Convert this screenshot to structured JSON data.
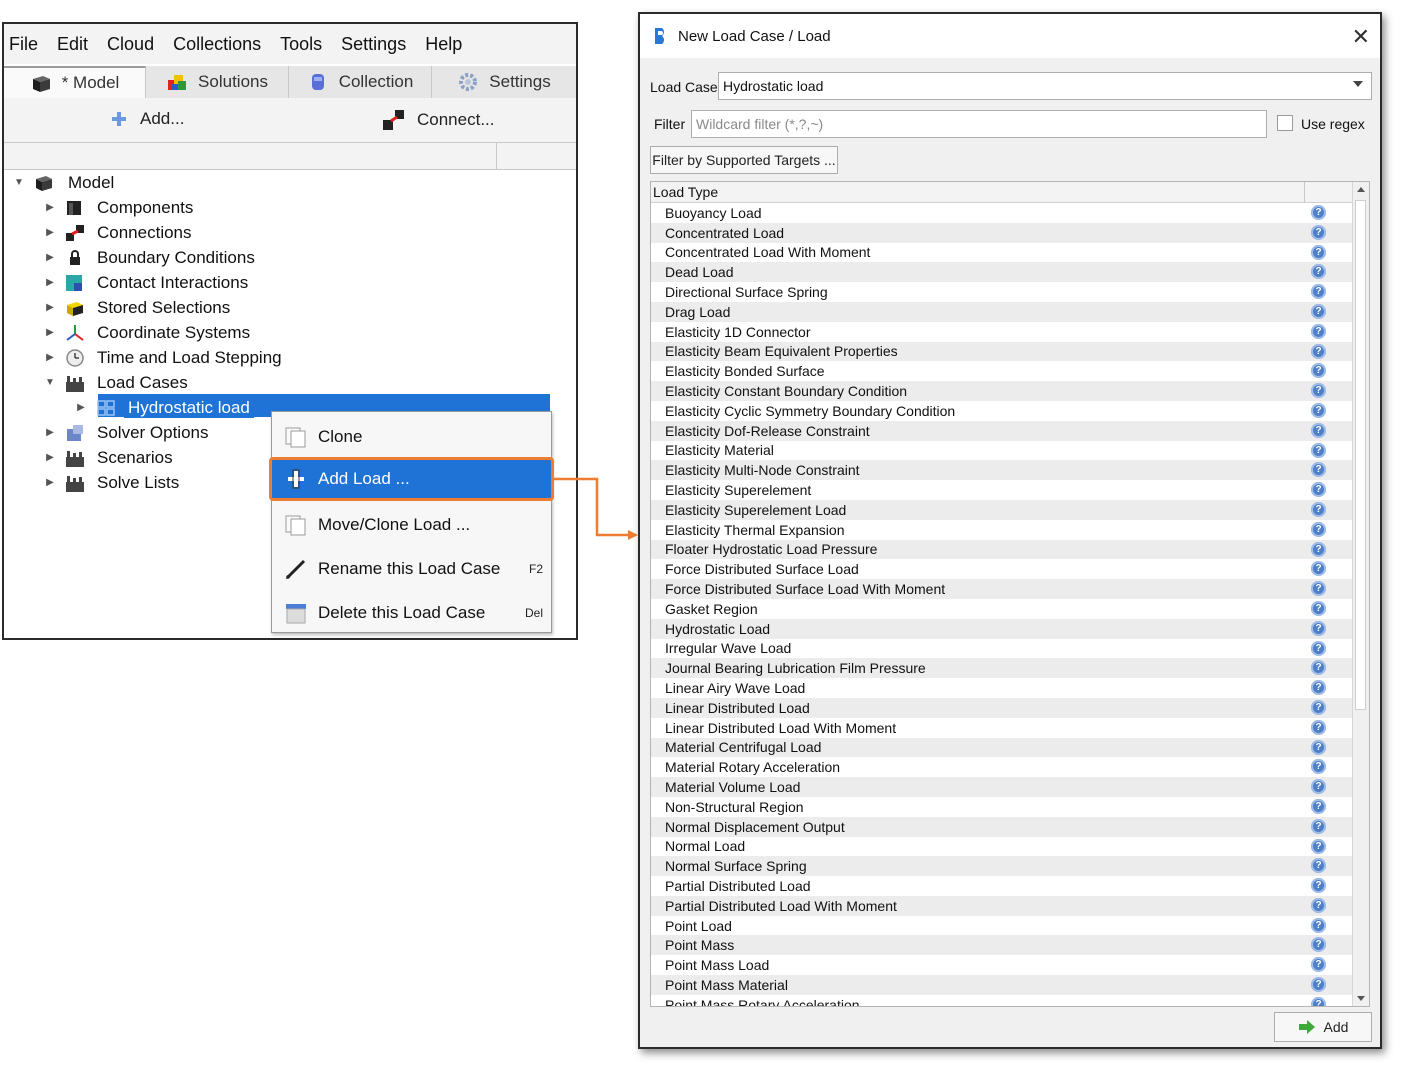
{
  "left_app": {
    "menu": [
      {
        "label": "File"
      },
      {
        "label": "Edit"
      },
      {
        "label": "Cloud"
      },
      {
        "label": "Collections"
      },
      {
        "label": "Tools"
      },
      {
        "label": "Settings"
      },
      {
        "label": "Help"
      }
    ],
    "tabs": [
      {
        "label": "* Model",
        "icon": "model-cube-icon",
        "active": true
      },
      {
        "label": "Solutions",
        "icon": "solutions-cubes-icon",
        "active": false
      },
      {
        "label": "Collection",
        "icon": "collection-icon",
        "active": false
      },
      {
        "label": "Settings",
        "icon": "gear-icon",
        "active": false
      }
    ],
    "toolbar": {
      "add_label": "Add...",
      "connect_label": "Connect..."
    },
    "tree": {
      "root": "Model",
      "items": [
        "Components",
        "Connections",
        "Boundary Conditions",
        "Contact Interactions",
        "Stored Selections",
        "Coordinate Systems",
        "Time and Load Stepping",
        "Load Cases",
        "Hydrostatic load",
        "Solver Options",
        "Scenarios",
        "Solve Lists"
      ]
    },
    "context_menu": {
      "clone": "Clone",
      "add_load": "Add Load ...",
      "move_clone": "Move/Clone Load ...",
      "rename": "Rename this Load Case",
      "rename_shortcut": "F2",
      "delete": "Delete this Load Case",
      "delete_shortcut": "Del"
    },
    "highlight_color": "#ed7d31",
    "selection_color": "#1f73d6"
  },
  "dialog": {
    "title": "New Load Case / Load",
    "load_case_label": "Load Case",
    "load_case_value": "Hydrostatic load",
    "filter_label": "Filter",
    "filter_placeholder": "Wildcard filter (*,?,~)",
    "use_regex_label": "Use regex",
    "filter_targets_button": "Filter by Supported Targets ...",
    "list_header": "Load Type",
    "load_types": [
      "Buoyancy Load",
      "Concentrated Load",
      "Concentrated Load With Moment",
      "Dead Load",
      "Directional Surface Spring",
      "Drag Load",
      "Elasticity 1D Connector",
      "Elasticity Beam Equivalent Properties",
      "Elasticity Bonded Surface",
      "Elasticity Constant Boundary Condition",
      "Elasticity Cyclic Symmetry Boundary Condition",
      "Elasticity Dof-Release Constraint",
      "Elasticity Material",
      "Elasticity Multi-Node Constraint",
      "Elasticity Superelement",
      "Elasticity Superelement Load",
      "Elasticity Thermal Expansion",
      "Floater Hydrostatic Load Pressure",
      "Force Distributed Surface Load",
      "Force Distributed Surface Load With Moment",
      "Gasket Region",
      "Hydrostatic Load",
      "Irregular Wave Load",
      "Journal Bearing Lubrication Film Pressure",
      "Linear Airy Wave Load",
      "Linear Distributed Load",
      "Linear Distributed Load With Moment",
      "Material Centrifugal Load",
      "Material Rotary Acceleration",
      "Material Volume Load",
      "Non-Structural Region",
      "Normal Displacement Output",
      "Normal Load",
      "Normal Surface Spring",
      "Partial Distributed Load",
      "Partial Distributed Load With Moment",
      "Point Load",
      "Point Mass",
      "Point Mass Load",
      "Point Mass Material",
      "Point Mass Rotary Acceleration"
    ],
    "add_button": "Add"
  }
}
